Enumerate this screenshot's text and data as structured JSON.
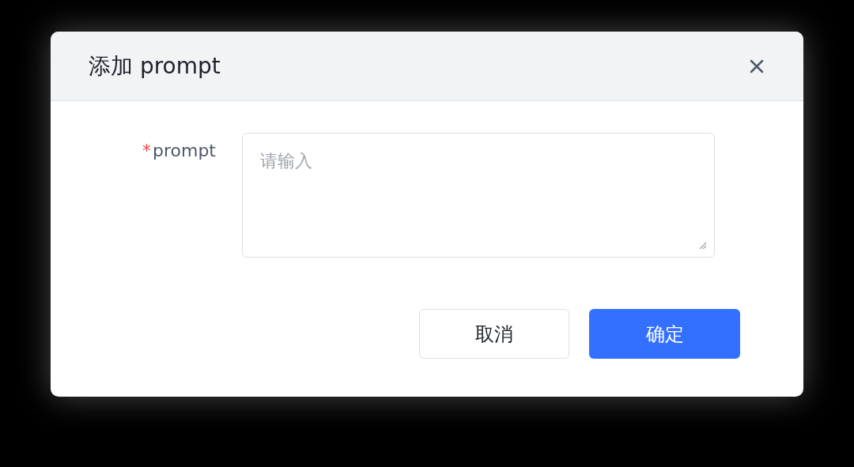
{
  "dialog": {
    "title": "添加 prompt"
  },
  "field": {
    "label": "prompt",
    "required_mark": "*",
    "placeholder": "请输入"
  },
  "buttons": [
    {
      "label": "取消",
      "kind": "secondary"
    },
    {
      "label": "确定",
      "kind": "primary"
    }
  ]
}
